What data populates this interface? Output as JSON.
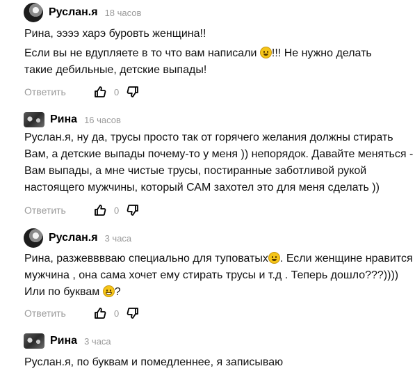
{
  "comments": [
    {
      "author": "Руслан.я",
      "time": "18 часов",
      "paragraphs": [
        "Рина, ээээ харэ буровть женщина!!"
      ],
      "p2_before": "Если вы не вдупляете в то что вам написали ",
      "p2_emoji": "grinning-face",
      "p2_after": "!!! Не нужно делать такие дебильные, детские выпады!",
      "reply_label": "Ответить",
      "votes": "0"
    },
    {
      "author": "Рина",
      "time": "16 часов",
      "text": "Руслан.я, ну да, трусы просто так от горячего желания должны стирать Вам, а детские выпады почему-то у меня )) непорядок. Давайте меняться - Вам выпады, а мне чистые трусы, постиранные заботливой рукой настоящего мужчины, который САМ захотел это для меня сделать ))",
      "reply_label": "Ответить",
      "votes": "0"
    },
    {
      "author": "Руслан.я",
      "time": "3 часа",
      "text_before": "Рина, разжевввваю специально для туповатых",
      "emoji1": "grinning-face",
      "text_middle": ". Если женщине нравится мужчина , она сама хочет ему стирать трусы и т.д . Теперь дошло???))))",
      "text_line3": "Или по буквам ",
      "emoji2": "laughing-face",
      "text_after": "?",
      "reply_label": "Ответить",
      "votes": "0"
    },
    {
      "author": "Рина",
      "time": "3 часа",
      "text": "Руслан.я, по буквам и помедленнее, я записываю"
    }
  ]
}
